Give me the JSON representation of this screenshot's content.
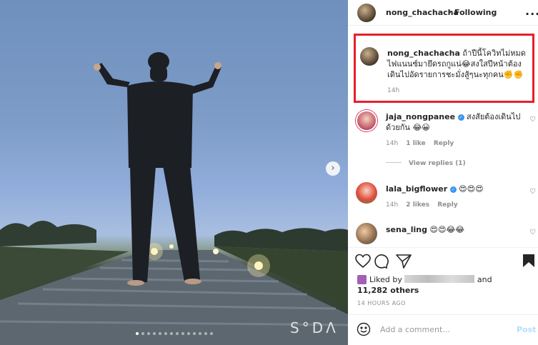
{
  "photo": {
    "watermark": "S°DΛ",
    "carousel_dots": 14,
    "active_dot": 0,
    "next_arrow": "chevron-right-icon"
  },
  "header": {
    "username": "nong_chachacha",
    "separator": "•",
    "follow_status": "Following",
    "more_icon": "more-icon",
    "more_label": "..."
  },
  "caption": {
    "username": "nong_chachacha",
    "text": " ถ้าปีนี้โควิทไม่หมด ไฟแนนซ์มายึดรถกูแน่😂สงใสปีหน้าต้อง เดินไปอัดรายการชะมั่งสู้ๆนะทุกคน✊✊",
    "time": "14h"
  },
  "comments": [
    {
      "username": "jaja_nongpanee",
      "verified": true,
      "text": "สงสัยต้องเดินไป ด้วยกัน 😂😀",
      "time": "14h",
      "likes": "1 like",
      "reply": "Reply",
      "view_replies": "View replies (1)"
    },
    {
      "username": "lala_bigflower",
      "verified": true,
      "text": "😍😍😍",
      "time": "14h",
      "likes": "2 likes",
      "reply": "Reply"
    },
    {
      "username": "sena_ling",
      "verified": false,
      "text": "😍😍😂😂"
    }
  ],
  "actions": {
    "like_icon": "heart-icon",
    "comment_icon": "comment-icon",
    "share_icon": "share-icon",
    "save_icon": "bookmark-icon"
  },
  "likes": {
    "prefix": "Liked by",
    "conjunction": "and",
    "others": "11,282 others"
  },
  "posted": "14 HOURS AGO",
  "add_comment": {
    "placeholder": "Add a comment...",
    "post_label": "Post"
  },
  "colors": {
    "highlight_border": "#e5202a",
    "verified_blue": "#3897f0",
    "post_disabled": "#b2dffc"
  }
}
